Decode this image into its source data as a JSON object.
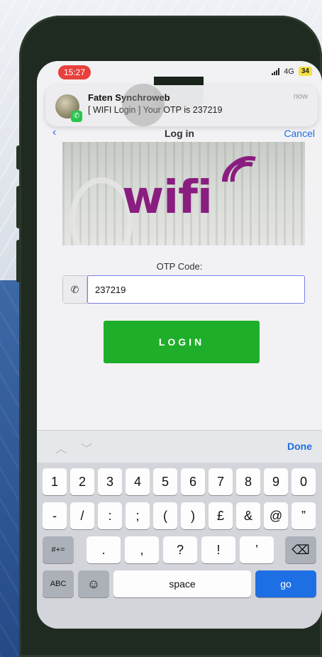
{
  "status": {
    "time": "15:27",
    "network": "4G",
    "battery": "34"
  },
  "notification": {
    "sender": "Faten Synchroweb",
    "message": "[ WIFI Login ] Your OTP is 237219",
    "time": "now"
  },
  "nav": {
    "title": "Log in",
    "back": "‹",
    "cancel": "Cancel"
  },
  "banner": {
    "logo_text": "wifi"
  },
  "form": {
    "otp_label": "OTP Code:",
    "otp_value": "237219",
    "login_button": "LOGIN"
  },
  "keyboard": {
    "done": "Done",
    "row1": [
      "1",
      "2",
      "3",
      "4",
      "5",
      "6",
      "7",
      "8",
      "9",
      "0"
    ],
    "row2": [
      "-",
      "/",
      ":",
      ";",
      "(",
      ")",
      "£",
      "&",
      "@",
      "”"
    ],
    "row3": [
      "#+=",
      ".",
      ",",
      "?",
      "!",
      "’",
      "⌫"
    ],
    "row4": [
      "ABC",
      "☺",
      "space",
      "go"
    ]
  },
  "colors": {
    "accent": "#1e6fe3",
    "login": "#1fae2a",
    "wifi_logo": "#8a1d80",
    "status_time": "#e8403c"
  }
}
